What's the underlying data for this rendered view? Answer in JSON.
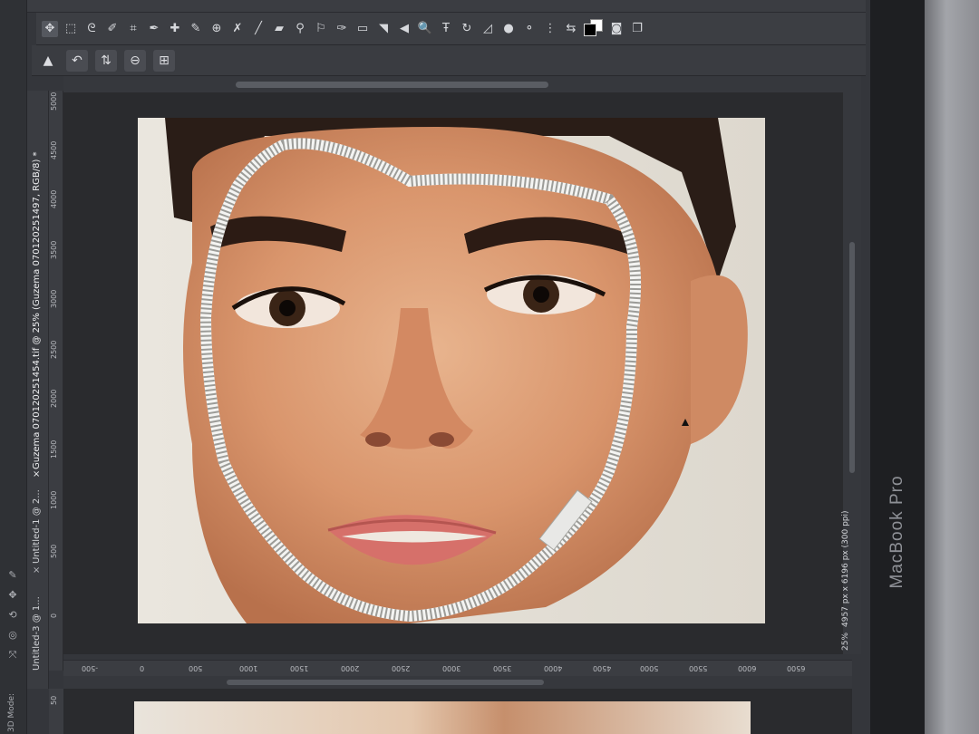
{
  "document_tabs": [
    {
      "label": "Guzema 070120251454.tif @ 25% (Guzema 070120251497, RGB/8) *",
      "active": true
    },
    {
      "label": "Untitled-1 @ 2...",
      "active": false
    },
    {
      "label": "Untitled-3 @ 1...",
      "active": false
    }
  ],
  "status": {
    "zoom": "25%",
    "dimensions": "4957 px x 6196 px (300 ppi)"
  },
  "left_panel": {
    "mode_label": "3D Mode:"
  },
  "device": {
    "brand": "MacBook Pro"
  },
  "rulers": {
    "vertical": [
      "5000",
      "4500",
      "4000",
      "3500",
      "3000",
      "2500",
      "2000",
      "1500",
      "1000",
      "500",
      "0"
    ],
    "vertical_bottom": "50",
    "horizontal": [
      "-500",
      "0",
      "500",
      "1000",
      "1500",
      "2000",
      "2500",
      "3000",
      "3500",
      "4000",
      "4500",
      "5000",
      "5500",
      "6000",
      "6500"
    ]
  },
  "toolbar_icons": [
    "move-icon",
    "marquee-icon",
    "lasso-icon",
    "quick-select-icon",
    "crop-icon",
    "eyedropper-icon",
    "healing-icon",
    "brush-icon",
    "clone-stamp-icon",
    "history-brush-icon",
    "eraser-icon",
    "gradient-icon",
    "blur-icon",
    "dodge-icon",
    "pen-icon",
    "type-icon",
    "path-select-icon",
    "shape-icon",
    "hand-icon",
    "zoom-icon"
  ],
  "colors": {
    "foreground": "#000000",
    "background": "#ffffff",
    "ui_dark": "#34363b",
    "canvas_bg": "#2a2b2e"
  }
}
